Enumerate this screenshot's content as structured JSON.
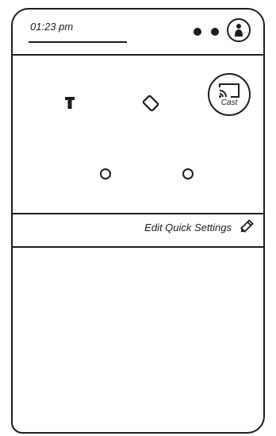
{
  "status_bar": {
    "time": "01:23 pm",
    "indicators": [
      "dot-icon",
      "dot-icon"
    ],
    "account_icon": "account-icon"
  },
  "quick_settings": {
    "tiles": [
      {
        "icon": "flashlight-icon",
        "label": ""
      },
      {
        "icon": "rotate-icon",
        "label": ""
      },
      {
        "icon": "cast-icon",
        "label": "Cast"
      },
      {
        "icon": "empty-tile-icon",
        "label": ""
      },
      {
        "icon": "empty-tile-icon",
        "label": ""
      }
    ],
    "edit_label": "Edit Quick Settings",
    "edit_icon": "pencil-icon"
  },
  "colors": {
    "ink": "#1c1c1c",
    "background": "#ffffff"
  }
}
